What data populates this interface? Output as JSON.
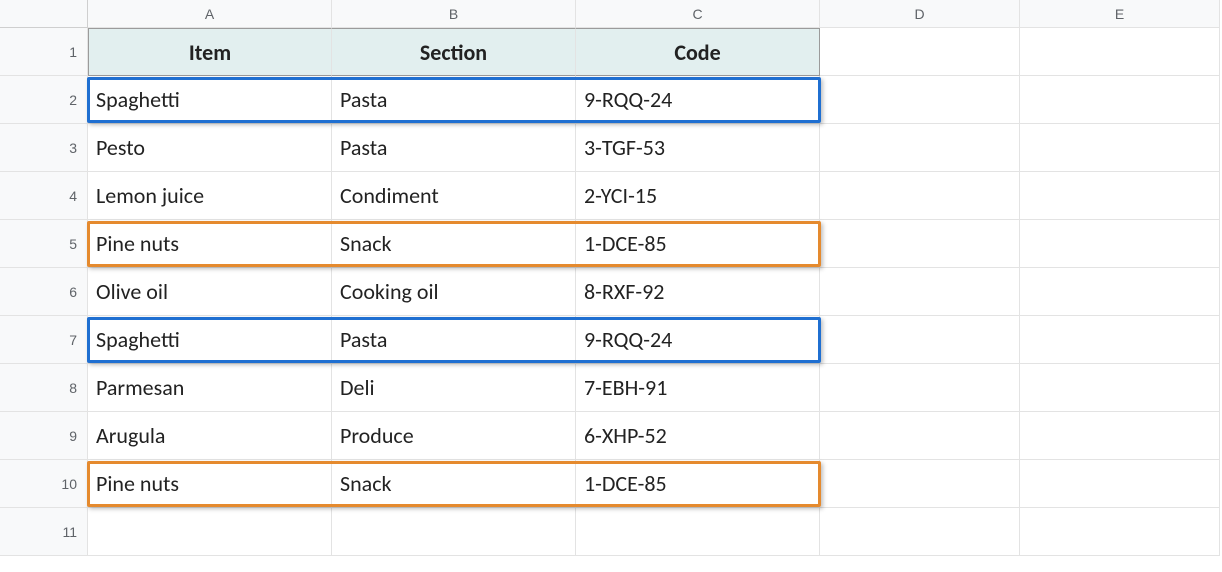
{
  "columns": [
    "A",
    "B",
    "C",
    "D",
    "E"
  ],
  "row_numbers": [
    "1",
    "2",
    "3",
    "4",
    "5",
    "6",
    "7",
    "8",
    "9",
    "10",
    "11"
  ],
  "headers": {
    "A": "Item",
    "B": "Section",
    "C": "Code"
  },
  "rows": [
    {
      "item": "Spaghetti",
      "section": "Pasta",
      "code": "9-RQQ-24",
      "highlight": "blue"
    },
    {
      "item": "Pesto",
      "section": "Pasta",
      "code": "3-TGF-53",
      "highlight": null
    },
    {
      "item": "Lemon juice",
      "section": "Condiment",
      "code": "2-YCI-15",
      "highlight": null
    },
    {
      "item": "Pine nuts",
      "section": "Snack",
      "code": "1-DCE-85",
      "highlight": "orange"
    },
    {
      "item": "Olive oil",
      "section": "Cooking oil",
      "code": "8-RXF-92",
      "highlight": null
    },
    {
      "item": "Spaghetti",
      "section": "Pasta",
      "code": "9-RQQ-24",
      "highlight": "blue"
    },
    {
      "item": "Parmesan",
      "section": "Deli",
      "code": "7-EBH-91",
      "highlight": null
    },
    {
      "item": "Arugula",
      "section": "Produce",
      "code": "6-XHP-52",
      "highlight": null
    },
    {
      "item": "Pine nuts",
      "section": "Snack",
      "code": "1-DCE-85",
      "highlight": "orange"
    }
  ],
  "chart_data": {
    "type": "table",
    "columns": [
      "Item",
      "Section",
      "Code"
    ],
    "data": [
      [
        "Spaghetti",
        "Pasta",
        "9-RQQ-24"
      ],
      [
        "Pesto",
        "Pasta",
        "3-TGF-53"
      ],
      [
        "Lemon juice",
        "Condiment",
        "2-YCI-15"
      ],
      [
        "Pine nuts",
        "Snack",
        "1-DCE-85"
      ],
      [
        "Olive oil",
        "Cooking oil",
        "8-RXF-92"
      ],
      [
        "Spaghetti",
        "Pasta",
        "9-RQQ-24"
      ],
      [
        "Parmesan",
        "Deli",
        "7-EBH-91"
      ],
      [
        "Arugula",
        "Produce",
        "6-XHP-52"
      ],
      [
        "Pine nuts",
        "Snack",
        "1-DCE-85"
      ]
    ],
    "duplicate_groups": [
      {
        "color": "blue",
        "row_indices": [
          0,
          5
        ]
      },
      {
        "color": "orange",
        "row_indices": [
          3,
          8
        ]
      }
    ]
  }
}
